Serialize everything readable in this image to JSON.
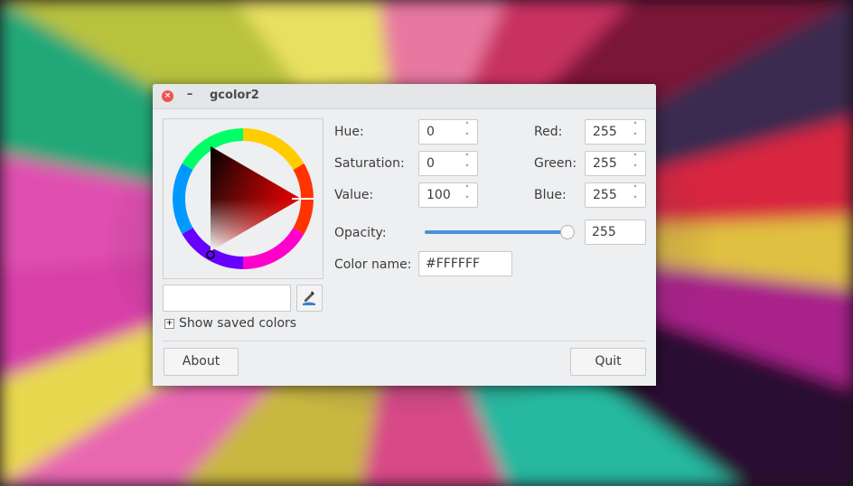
{
  "window": {
    "title": "gcolor2"
  },
  "color": {
    "hue_label": "Hue:",
    "hue": "0",
    "saturation_label": "Saturation:",
    "saturation": "0",
    "value_label": "Value:",
    "value": "100",
    "red_label": "Red:",
    "red": "255",
    "green_label": "Green:",
    "green": "255",
    "blue_label": "Blue:",
    "blue": "255",
    "opacity_label": "Opacity:",
    "opacity": "255",
    "opacity_fraction": 1.0,
    "color_name_label": "Color name:",
    "color_name": "#FFFFFF"
  },
  "expander": {
    "label": "Show saved colors",
    "toggle": "+"
  },
  "buttons": {
    "about": "About",
    "quit": "Quit"
  },
  "spin_arrows": {
    "up": "˄",
    "down": "˅"
  },
  "titlebar": {
    "close": "×",
    "minimize": "–"
  }
}
